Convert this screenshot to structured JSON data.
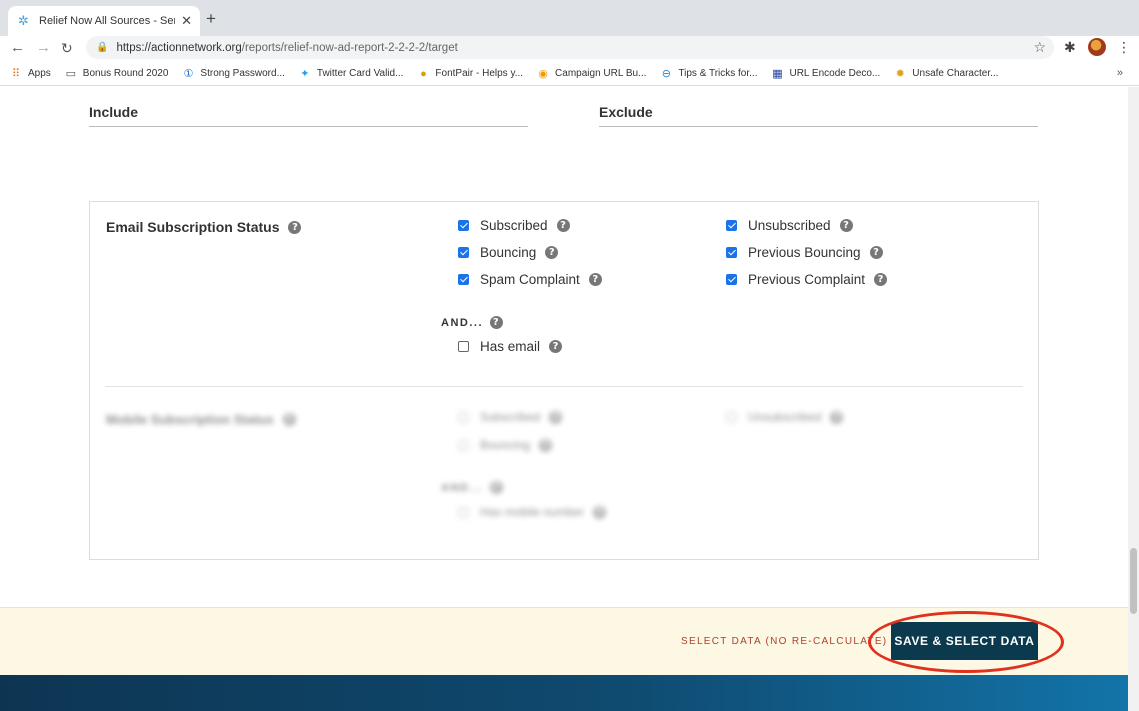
{
  "browser": {
    "tab_title": "Relief Now All Sources - Sent t",
    "url_domain": "https://actionnetwork.org",
    "url_path": "/reports/relief-now-ad-report-2-2-2-2/target",
    "bookmarks": [
      {
        "label": "Apps",
        "icon": "apps-grid-icon"
      },
      {
        "label": "Bonus Round 2020",
        "icon": "folder-icon"
      },
      {
        "label": "Strong Password...",
        "icon": "onepassword-icon"
      },
      {
        "label": "Twitter Card Valid...",
        "icon": "twitter-icon"
      },
      {
        "label": "FontPair - Helps y...",
        "icon": "fontpair-icon"
      },
      {
        "label": "Campaign URL Bu...",
        "icon": "analytics-icon"
      },
      {
        "label": "Tips & Tricks for...",
        "icon": "tips-icon"
      },
      {
        "label": "URL Encode Deco...",
        "icon": "url-encode-icon"
      },
      {
        "label": "Unsafe Character...",
        "icon": "unsafe-char-icon"
      }
    ]
  },
  "columns": {
    "include": "Include",
    "exclude": "Exclude"
  },
  "email_status": {
    "title": "Email Subscription Status",
    "options": [
      {
        "label": "Subscribed",
        "checked": true
      },
      {
        "label": "Bouncing",
        "checked": true
      },
      {
        "label": "Spam Complaint",
        "checked": true
      },
      {
        "label": "Unsubscribed",
        "checked": true
      },
      {
        "label": "Previous Bouncing",
        "checked": true
      },
      {
        "label": "Previous Complaint",
        "checked": true
      }
    ],
    "and_label": "AND...",
    "has_email": {
      "label": "Has email",
      "checked": false
    }
  },
  "mobile_status": {
    "title": "Mobile Subscription Status",
    "options": [
      {
        "label": "Subscribed",
        "checked": false
      },
      {
        "label": "Bouncing",
        "checked": false
      },
      {
        "label": "Unsubscribed",
        "checked": false
      }
    ],
    "and_label": "AND...",
    "has_mobile": {
      "label": "Has mobile number",
      "checked": false
    }
  },
  "actions": {
    "select_data_label": "SELECT DATA (NO RE-CALCULATE)",
    "save_select_label": "SAVE & SELECT DATA"
  },
  "colors": {
    "save_button_bg": "#0b3a4e",
    "action_bar_bg": "#fcf8e3",
    "highlight_ring": "#e0311f",
    "checkbox_checked": "#1a73e8"
  }
}
